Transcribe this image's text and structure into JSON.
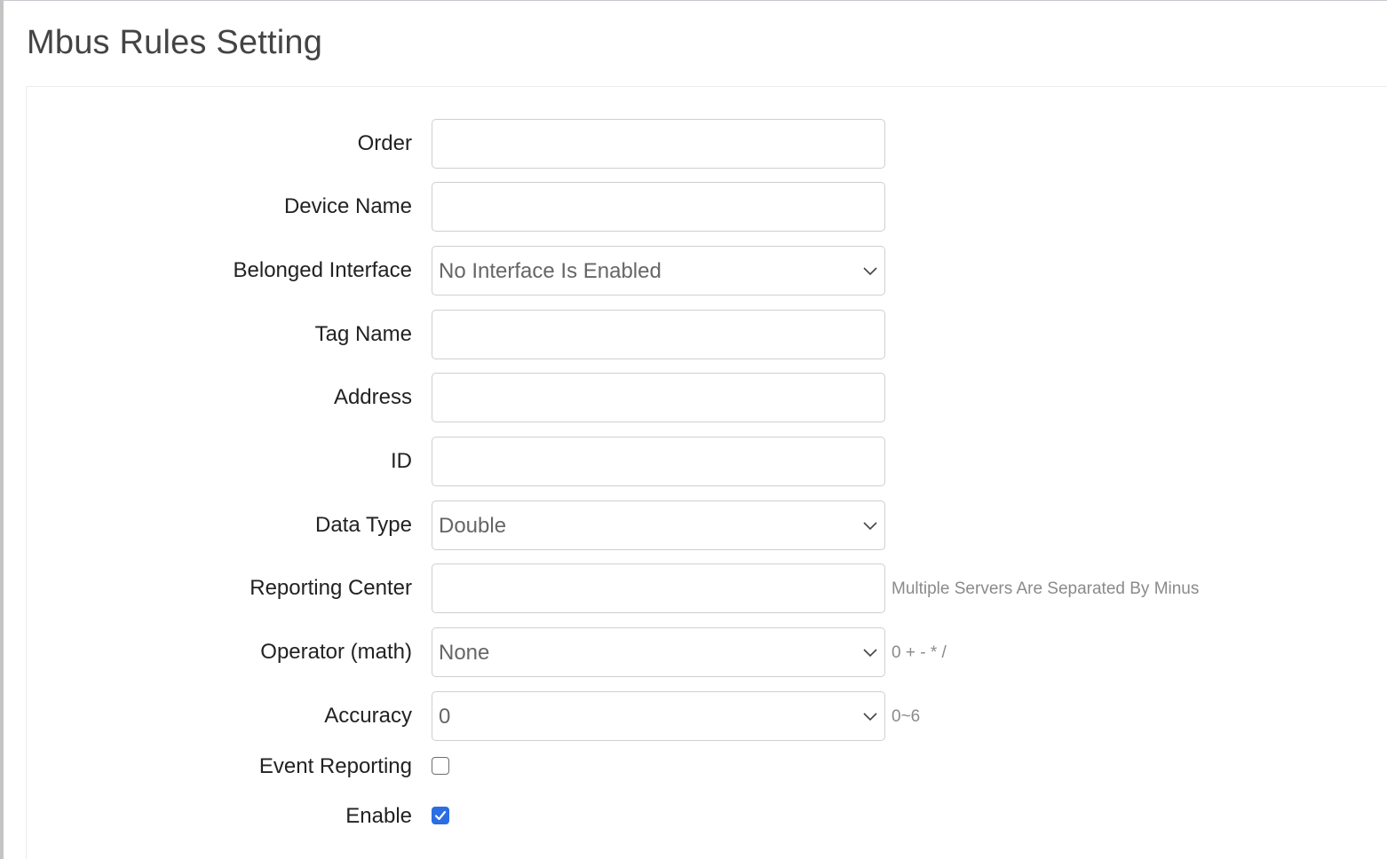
{
  "page": {
    "title": "Mbus Rules Setting"
  },
  "form": {
    "order": {
      "label": "Order",
      "value": ""
    },
    "device_name": {
      "label": "Device Name",
      "value": ""
    },
    "belonged_interface": {
      "label": "Belonged Interface",
      "selected": "No Interface Is Enabled"
    },
    "tag_name": {
      "label": "Tag Name",
      "value": ""
    },
    "address": {
      "label": "Address",
      "value": ""
    },
    "id": {
      "label": "ID",
      "value": ""
    },
    "data_type": {
      "label": "Data Type",
      "selected": "Double"
    },
    "reporting_center": {
      "label": "Reporting Center",
      "value": "",
      "hint": "Multiple Servers Are Separated By Minus"
    },
    "operator": {
      "label": "Operator (math)",
      "selected": "None",
      "hint": "0 + - * /"
    },
    "accuracy": {
      "label": "Accuracy",
      "selected": "0",
      "hint": "0~6"
    },
    "event_reporting": {
      "label": "Event Reporting",
      "checked": false
    },
    "enable": {
      "label": "Enable",
      "checked": true
    }
  },
  "icons": {
    "select_arrow": "chevron-down-icon",
    "checkbox_check": "check-icon"
  },
  "colors": {
    "accent": "#2b6de3",
    "title": "#444444",
    "hint": "#8a8a8a",
    "border": "#cfcfcf"
  }
}
